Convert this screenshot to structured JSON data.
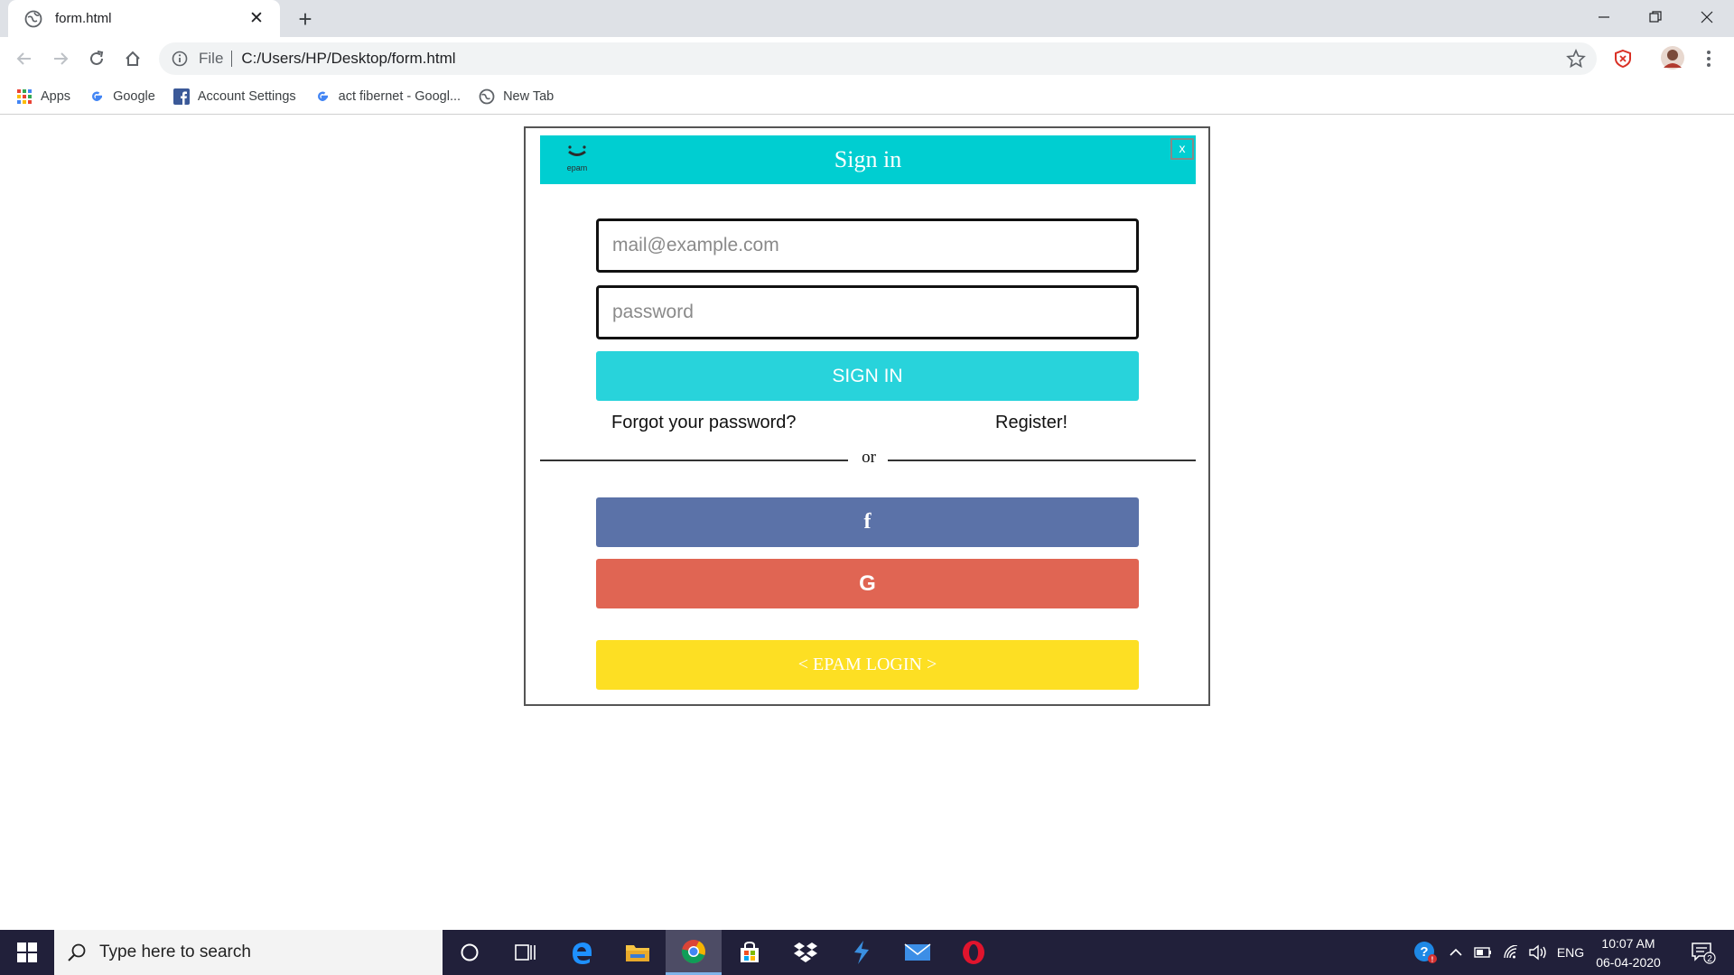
{
  "browser": {
    "tab_title": "form.html",
    "new_tab_symbol": "+",
    "tab_close_symbol": "✕",
    "address_scheme": "File",
    "address_url": "C:/Users/HP/Desktop/form.html",
    "bookmarks": [
      {
        "label": "Apps",
        "icon": "apps-grid-icon"
      },
      {
        "label": "Google",
        "icon": "google-icon"
      },
      {
        "label": "Account Settings",
        "icon": "facebook-icon"
      },
      {
        "label": "act fibernet - Googl...",
        "icon": "google-icon"
      },
      {
        "label": "New Tab",
        "icon": "globe-icon"
      }
    ]
  },
  "modal": {
    "title": "Sign in",
    "close_label": "x",
    "logo_text": "epam",
    "email_placeholder": "mail@example.com",
    "password_placeholder": "password",
    "signin_label": "SIGN IN",
    "forgot_label": "Forgot your password?",
    "register_label": "Register!",
    "divider_text": "or",
    "facebook_label": "f",
    "google_label": "G",
    "epam_label": "< EPAM LOGIN >"
  },
  "colors": {
    "header": "#00ced1",
    "signin": "#28d3db",
    "facebook": "#5b72a8",
    "google": "#e06553",
    "epam": "#fddf23"
  },
  "taskbar": {
    "search_placeholder": "Type here to search",
    "language": "ENG",
    "time": "10:07 AM",
    "date": "06-04-2020",
    "notification_count": "2"
  }
}
